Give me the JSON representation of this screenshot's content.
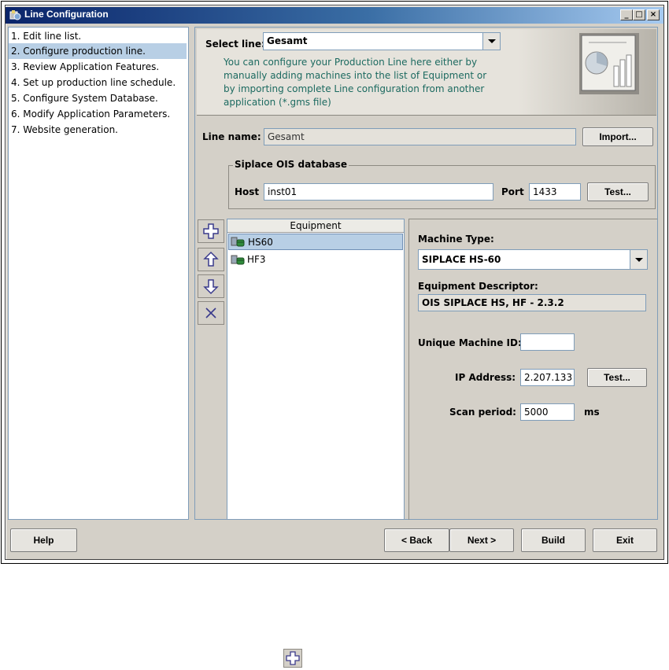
{
  "window": {
    "title": "Line Configuration",
    "controls": {
      "minimize": "_",
      "maximize": "□",
      "close": "×"
    }
  },
  "steps": [
    {
      "label": "1. Edit line list.",
      "selected": false
    },
    {
      "label": "2. Configure production line.",
      "selected": true
    },
    {
      "label": "3. Review Application Features.",
      "selected": false
    },
    {
      "label": "4. Set up production line schedule.",
      "selected": false
    },
    {
      "label": "5. Configure System Database.",
      "selected": false
    },
    {
      "label": "6. Modify Application Parameters.",
      "selected": false
    },
    {
      "label": "7. Website generation.",
      "selected": false
    }
  ],
  "header": {
    "select_line_label": "Select line:",
    "select_line_value": "Gesamt",
    "description_lines": [
      "You can configure your Production Line here either by",
      "manually adding machines into the list of Equipment or",
      "by importing complete Line configuration from another",
      "application (*.gms file)"
    ]
  },
  "line": {
    "name_label": "Line name:",
    "name_value": "Gesamt",
    "import_button": "Import..."
  },
  "ois": {
    "group_title": "Siplace OIS database",
    "host_label": "Host",
    "host_value": "inst01",
    "port_label": "Port",
    "port_value": "1433",
    "test_button": "Test..."
  },
  "equipment": {
    "header": "Equipment",
    "items": [
      {
        "name": "HS60",
        "selected": true
      },
      {
        "name": "HF3",
        "selected": false
      }
    ],
    "buttons": {
      "add": "plus-icon",
      "move_up": "arrow-up-icon",
      "move_down": "arrow-down-icon",
      "remove": "x-icon"
    }
  },
  "machine": {
    "type_label": "Machine Type:",
    "type_value": "SIPLACE HS-60",
    "descriptor_label": "Equipment Descriptor:",
    "descriptor_value": "OIS SIPLACE HS, HF - 2.3.2",
    "unique_id_label": "Unique Machine ID:",
    "unique_id_value": "",
    "ip_label": "IP Address:",
    "ip_value": "2.207.133",
    "ip_test_button": "Test...",
    "scan_label": "Scan period:",
    "scan_value": "5000",
    "scan_unit": "ms"
  },
  "footer": {
    "help": "Help",
    "back": "< Back",
    "next": "Next >",
    "build": "Build",
    "exit": "Exit"
  },
  "colors": {
    "title_gradient_start": "#0a246a",
    "selection": "#b8cfe5",
    "description_text": "#1c6a60"
  }
}
